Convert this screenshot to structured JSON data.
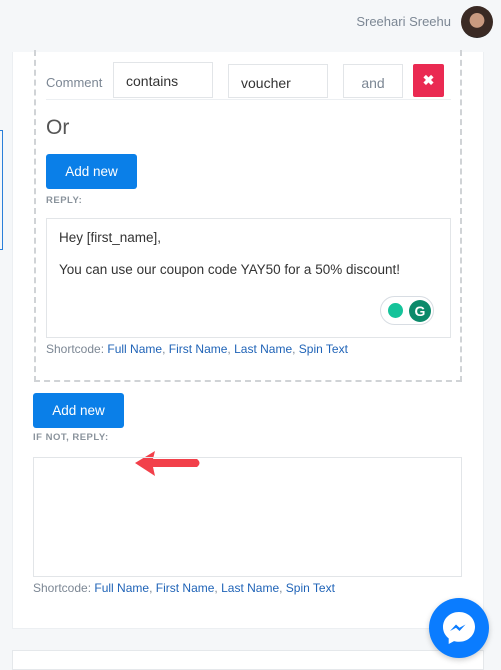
{
  "header": {
    "username": "Sreehari Sreehu"
  },
  "condition": {
    "label": "Comment",
    "operator": "contains",
    "value": "voucher",
    "joiner": "and",
    "delete_icon": "close-icon",
    "delete_color": "#ea2a52"
  },
  "or_label": "Or",
  "add_new_label": "Add new",
  "reply": {
    "caption": "REPLY:",
    "line1": "Hey [first_name],",
    "line2": "You can use our coupon code YAY50 for a 50% discount!"
  },
  "shortcode": {
    "label": "Shortcode:",
    "links": [
      "Full Name",
      "First Name",
      "Last Name",
      "Spin Text"
    ]
  },
  "outer_add_new_label": "Add new",
  "if_not": {
    "caption": "IF NOT, REPLY:",
    "value": ""
  },
  "accent": "#0a7fe8"
}
